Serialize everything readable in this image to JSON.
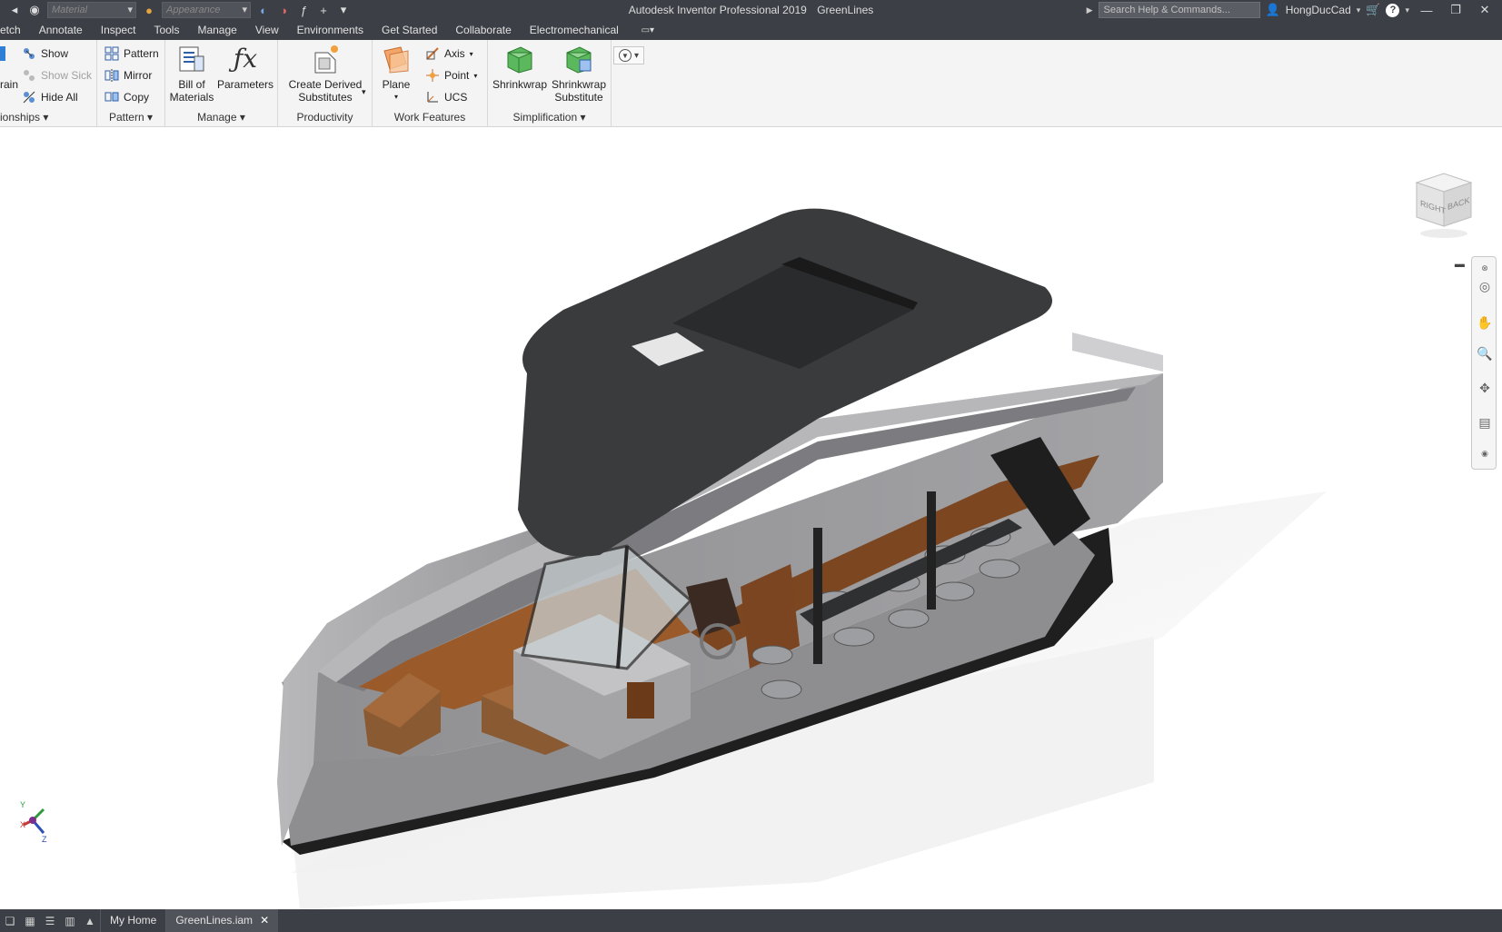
{
  "titlebar": {
    "material_placeholder": "Material",
    "appearance_placeholder": "Appearance",
    "app_name": "Autodesk Inventor Professional 2019",
    "document_name": "GreenLines",
    "search_placeholder": "Search Help & Commands...",
    "user_name": "HongDucCad"
  },
  "menu": {
    "tabs": [
      "etch",
      "Annotate",
      "Inspect",
      "Tools",
      "Manage",
      "View",
      "Environments",
      "Get Started",
      "Collaborate",
      "Electromechanical"
    ]
  },
  "ribbon": {
    "relationships": {
      "show": "Show",
      "show_sick": "Show Sick",
      "hide_all": "Hide All",
      "frag_rain": "rain",
      "title": "ionships"
    },
    "pattern": {
      "pattern": "Pattern",
      "mirror": "Mirror",
      "copy": "Copy",
      "title": "Pattern"
    },
    "manage": {
      "bom_line1": "Bill of",
      "bom_line2": "Materials",
      "parameters": "Parameters",
      "title": "Manage"
    },
    "productivity": {
      "derived_line1": "Create Derived",
      "derived_line2": "Substitutes",
      "title": "Productivity"
    },
    "work_features": {
      "plane": "Plane",
      "axis": "Axis",
      "point": "Point",
      "ucs": "UCS",
      "title": "Work Features"
    },
    "simplification": {
      "shrinkwrap": "Shrinkwrap",
      "shrinkwrap_sub_line1": "Shrinkwrap",
      "shrinkwrap_sub_line2": "Substitute",
      "title": "Simplification"
    }
  },
  "viewcube": {
    "face_right": "RIGHT",
    "face_back": "BACK"
  },
  "triad": {
    "x": "X",
    "y": "Y",
    "z": "Z"
  },
  "statusbar": {
    "home_tab": "My Home",
    "doc_tab": "GreenLines.iam"
  },
  "colors": {
    "chrome": "#3c3f45",
    "ribbon": "#f4f4f4",
    "hull": "#9a9a9d",
    "hull_dark": "#1e1e1f",
    "roof": "#3a3b3d",
    "deck_wood": "#9b5a2a",
    "cushion": "#8a5a33"
  }
}
